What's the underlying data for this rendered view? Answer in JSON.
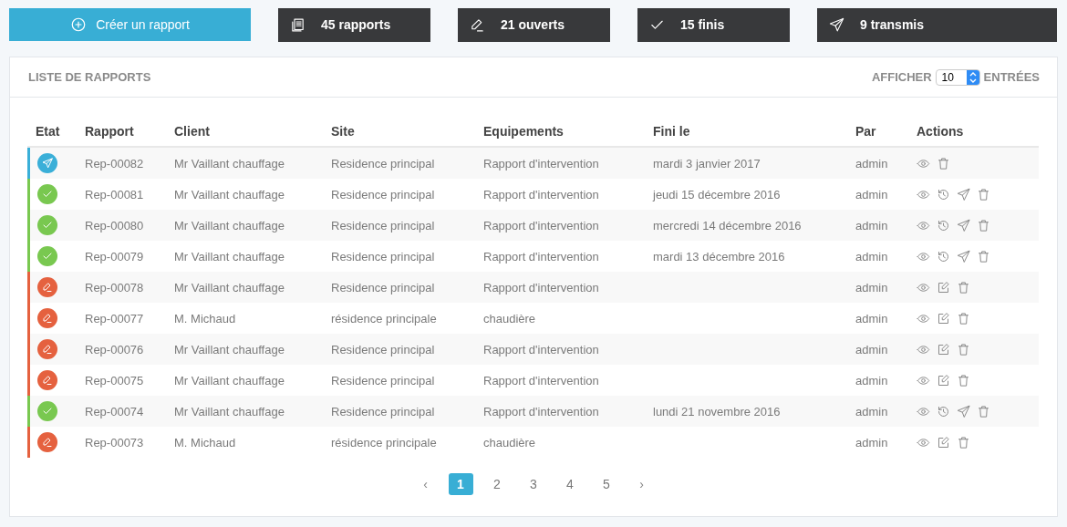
{
  "create_button": {
    "label": "Créer un rapport"
  },
  "stats": [
    {
      "kind": "reports",
      "label": "45 rapports"
    },
    {
      "kind": "open",
      "label": "21 ouverts"
    },
    {
      "kind": "done",
      "label": "15 finis"
    },
    {
      "kind": "sent",
      "label": "9 transmis"
    }
  ],
  "panel": {
    "title": "LISTE DE RAPPORTS",
    "show_label": "AFFICHER",
    "page_size": "10",
    "entries_label": "ENTRÉES"
  },
  "table": {
    "columns": [
      "Etat",
      "Rapport",
      "Client",
      "Site",
      "Equipements",
      "Fini le",
      "Par",
      "Actions"
    ],
    "rows": [
      {
        "kind": "sent",
        "report": "Rep-00082",
        "client": "Mr Vaillant chauffage",
        "site": "Residence principal",
        "equipment": "Rapport d'intervention",
        "finished": "mardi 3 janvier 2017",
        "by": "admin"
      },
      {
        "kind": "done",
        "report": "Rep-00081",
        "client": "Mr Vaillant chauffage",
        "site": "Residence principal",
        "equipment": "Rapport d'intervention",
        "finished": "jeudi 15 décembre 2016",
        "by": "admin"
      },
      {
        "kind": "done",
        "report": "Rep-00080",
        "client": "Mr Vaillant chauffage",
        "site": "Residence principal",
        "equipment": "Rapport d'intervention",
        "finished": "mercredi 14 décembre 2016",
        "by": "admin"
      },
      {
        "kind": "done",
        "report": "Rep-00079",
        "client": "Mr Vaillant chauffage",
        "site": "Residence principal",
        "equipment": "Rapport d'intervention",
        "finished": "mardi 13 décembre 2016",
        "by": "admin"
      },
      {
        "kind": "open",
        "report": "Rep-00078",
        "client": "Mr Vaillant chauffage",
        "site": "Residence principal",
        "equipment": "Rapport d'intervention",
        "by": "admin"
      },
      {
        "kind": "open",
        "report": "Rep-00077",
        "client": "M. Michaud",
        "site": "résidence principale",
        "equipment": "chaudière",
        "by": "admin"
      },
      {
        "kind": "open",
        "report": "Rep-00076",
        "client": "Mr Vaillant chauffage",
        "site": "Residence principal",
        "equipment": "Rapport d'intervention",
        "by": "admin"
      },
      {
        "kind": "open",
        "report": "Rep-00075",
        "client": "Mr Vaillant chauffage",
        "site": "Residence principal",
        "equipment": "Rapport d'intervention",
        "by": "admin"
      },
      {
        "kind": "done",
        "report": "Rep-00074",
        "client": "Mr Vaillant chauffage",
        "site": "Residence principal",
        "equipment": "Rapport d'intervention",
        "finished": "lundi 21 novembre 2016",
        "by": "admin"
      },
      {
        "kind": "open",
        "report": "Rep-00073",
        "client": "M. Michaud",
        "site": "résidence principale",
        "equipment": "chaudière",
        "by": "admin"
      }
    ]
  },
  "pagination": {
    "prev": "‹",
    "pages": [
      {
        "label": "1",
        "selected": true
      },
      {
        "label": "2",
        "selected": false
      },
      {
        "label": "3",
        "selected": false
      },
      {
        "label": "4",
        "selected": false
      },
      {
        "label": "5",
        "selected": false
      }
    ],
    "next": "›"
  }
}
